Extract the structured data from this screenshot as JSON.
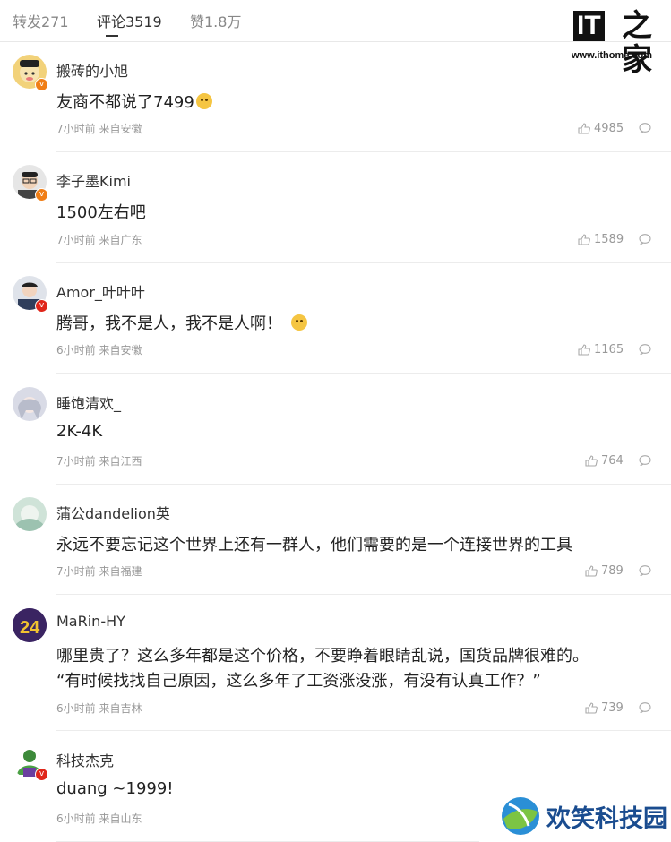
{
  "tabs": [
    {
      "label": "转发271"
    },
    {
      "label": "评论3519",
      "active": true
    },
    {
      "label": "赞1.8万"
    }
  ],
  "logo": {
    "it": "IT",
    "zh": "之家",
    "url": "www.ithome.com"
  },
  "comments": [
    {
      "user": "搬砖的小旭",
      "text": "友商不都说了7499",
      "emoji": true,
      "time": "7小时前 来自安徽",
      "likes": "4985",
      "badge": "orange",
      "avatar_color": "#f2d27a"
    },
    {
      "user": "李子墨Kimi",
      "text": "1500左右吧",
      "time": "7小时前 来自广东",
      "likes": "1589",
      "badge": "orange",
      "avatar_color": "#d9d9d9"
    },
    {
      "user": "Amor_叶叶叶",
      "text": "腾哥，我不是人，我不是人啊！",
      "emoji": true,
      "time": "6小时前 来自安徽",
      "likes": "1165",
      "badge": "red",
      "avatar_color": "#3a4a66"
    },
    {
      "user": "睡饱清欢_",
      "text": "2K-4K",
      "time": "7小时前 来自江西",
      "likes": "764",
      "badge": "",
      "avatar_color": "#c9c9d6"
    },
    {
      "user": "蒲公dandelion英",
      "text": "永远不要忘记这个世界上还有一群人，他们需要的是一个连接世界的工具",
      "time": "7小时前 来自福建",
      "likes": "789",
      "badge": "",
      "avatar_color": "#b9d7c6"
    },
    {
      "user": "MaRin-HY",
      "text": "哪里贵了？这么多年都是这个价格，不要睁着眼睛乱说，国货品牌很难的。",
      "text2": "“有时候找找自己原因，这么多年了工资涨没涨，有没有认真工作？”",
      "time": "6小时前 来自吉林",
      "likes": "739",
      "badge": "",
      "avatar_color": "#4b2f7a"
    },
    {
      "user": "科技杰克",
      "text": "duang ~1999!",
      "time": "6小时前 来自山东",
      "likes": "",
      "badge": "red",
      "avatar_color": "#3d8a3a"
    }
  ],
  "watermark": {
    "text": "欢笑科技园"
  }
}
